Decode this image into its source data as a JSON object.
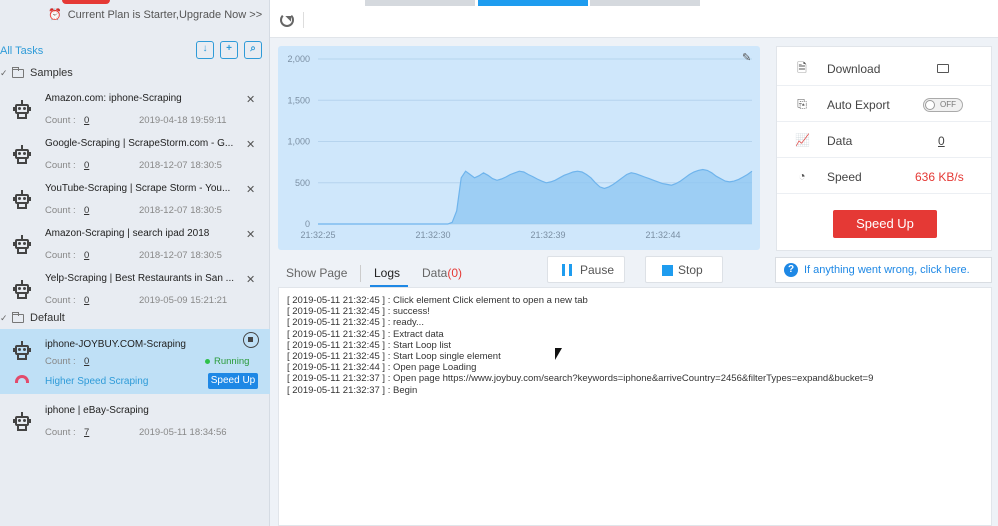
{
  "plan": {
    "text": "Current Plan is Starter,Upgrade Now >>"
  },
  "sidebar": {
    "all_tasks_label": "All Tasks",
    "groups": [
      {
        "label": "Samples"
      },
      {
        "label": "Default"
      }
    ],
    "tasks": [
      {
        "title": "Amazon.com: iphone-Scraping",
        "count_label": "Count :",
        "count": "0",
        "date": "2019-04-18 19:59:11"
      },
      {
        "title": "Google-Scraping | ScrapeStorm.com - G...",
        "count_label": "Count :",
        "count": "0",
        "date": "2018-12-07 18:30:5"
      },
      {
        "title": "YouTube-Scraping | Scrape Storm - You...",
        "count_label": "Count :",
        "count": "0",
        "date": "2018-12-07 18:30:5"
      },
      {
        "title": "Amazon-Scraping | search ipad 2018",
        "count_label": "Count :",
        "count": "0",
        "date": "2018-12-07 18:30:5"
      },
      {
        "title": "Yelp-Scraping | Best Restaurants in San ...",
        "count_label": "Count :",
        "count": "0",
        "date": "2019-05-09 15:21:21"
      }
    ],
    "active_task": {
      "title": "iphone-JOYBUY.COM-Scraping",
      "count_label": "Count :",
      "count": "0",
      "status": "Running",
      "higher_speed_label": "Higher Speed Scraping",
      "speed_up_label": "Speed Up"
    },
    "last_task": {
      "title": "iphone | eBay-Scraping",
      "count_label": "Count :",
      "count": "7",
      "date": "2019-05-11 18:34:56"
    }
  },
  "stats": {
    "download_label": "Download",
    "auto_export_label": "Auto Export",
    "auto_export_state": "OFF",
    "data_label": "Data",
    "data_value": "0",
    "speed_label": "Speed",
    "speed_value": "636 KB/s",
    "speed_up_label": "Speed Up"
  },
  "tabs": {
    "show_page": "Show Page",
    "logs": "Logs",
    "data": "Data",
    "data_count": "(0)"
  },
  "controls": {
    "pause": "Pause",
    "stop": "Stop"
  },
  "help": {
    "text": "If anything went wrong, click here."
  },
  "logs": [
    "[ 2019-05-11 21:32:45 ] : Click element Click element to open a new tab",
    "[ 2019-05-11 21:32:45 ] : success!",
    "[ 2019-05-11 21:32:45 ] : ready...",
    "[ 2019-05-11 21:32:45 ] : Extract data",
    "[ 2019-05-11 21:32:45 ] : Start Loop list",
    "[ 2019-05-11 21:32:45 ] : Start Loop single element",
    "[ 2019-05-11 21:32:44 ] : Open page Loading",
    "[ 2019-05-11 21:32:37 ] : Open page https://www.joybuy.com/search?keywords=iphone&arriveCountry=2456&filterTypes=expand&bucket=9",
    "[ 2019-05-11 21:32:37 ] : Begin"
  ],
  "speed_chart": {
    "y_ticks": [
      "2,000",
      "1,500",
      "1,000",
      "500",
      "0"
    ],
    "x_ticks": [
      "21:32:25",
      "21:32:30",
      "21:32:39",
      "21:32:44"
    ],
    "ylim": [
      0,
      2000
    ],
    "values": [
      0,
      0,
      0,
      0,
      0,
      0,
      0,
      0,
      0,
      0,
      0,
      0,
      0,
      0,
      0,
      0,
      0,
      0,
      0,
      0,
      0,
      0,
      0,
      0,
      0,
      0,
      0,
      0,
      0,
      0,
      20,
      160,
      560,
      640,
      600,
      560,
      585,
      620,
      590,
      550,
      530,
      545,
      570,
      600,
      620,
      640,
      630,
      600,
      575,
      545,
      520,
      500,
      510,
      530,
      560,
      590,
      610,
      630,
      640,
      630,
      600,
      560,
      500,
      450,
      430,
      450,
      480,
      520,
      560,
      600,
      620,
      610,
      590,
      570,
      550,
      530,
      510,
      490,
      480,
      470,
      490,
      520,
      560,
      600,
      630,
      650,
      660,
      650,
      620,
      580,
      550,
      520,
      510,
      520,
      540,
      570,
      600,
      640
    ]
  }
}
